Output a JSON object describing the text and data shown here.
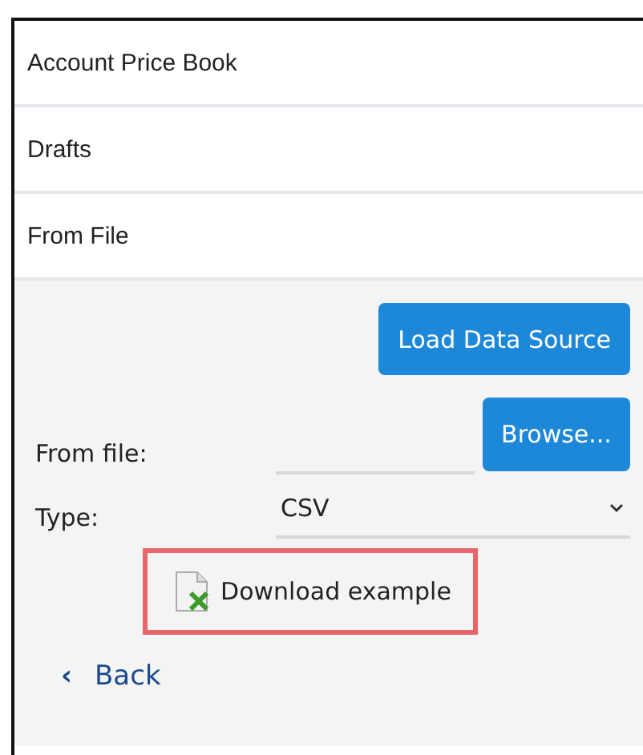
{
  "menu": [
    {
      "label": "Account Price Book"
    },
    {
      "label": "Drafts"
    },
    {
      "label": "From File"
    }
  ],
  "form": {
    "load_button": "Load Data Source",
    "from_file": {
      "label": "From file:",
      "button": "Browse..."
    },
    "type": {
      "label": "Type:",
      "value": "CSV"
    },
    "download": {
      "label": "Download example",
      "highlighted": true
    },
    "back": {
      "label": "Back",
      "icon": "‹"
    }
  }
}
